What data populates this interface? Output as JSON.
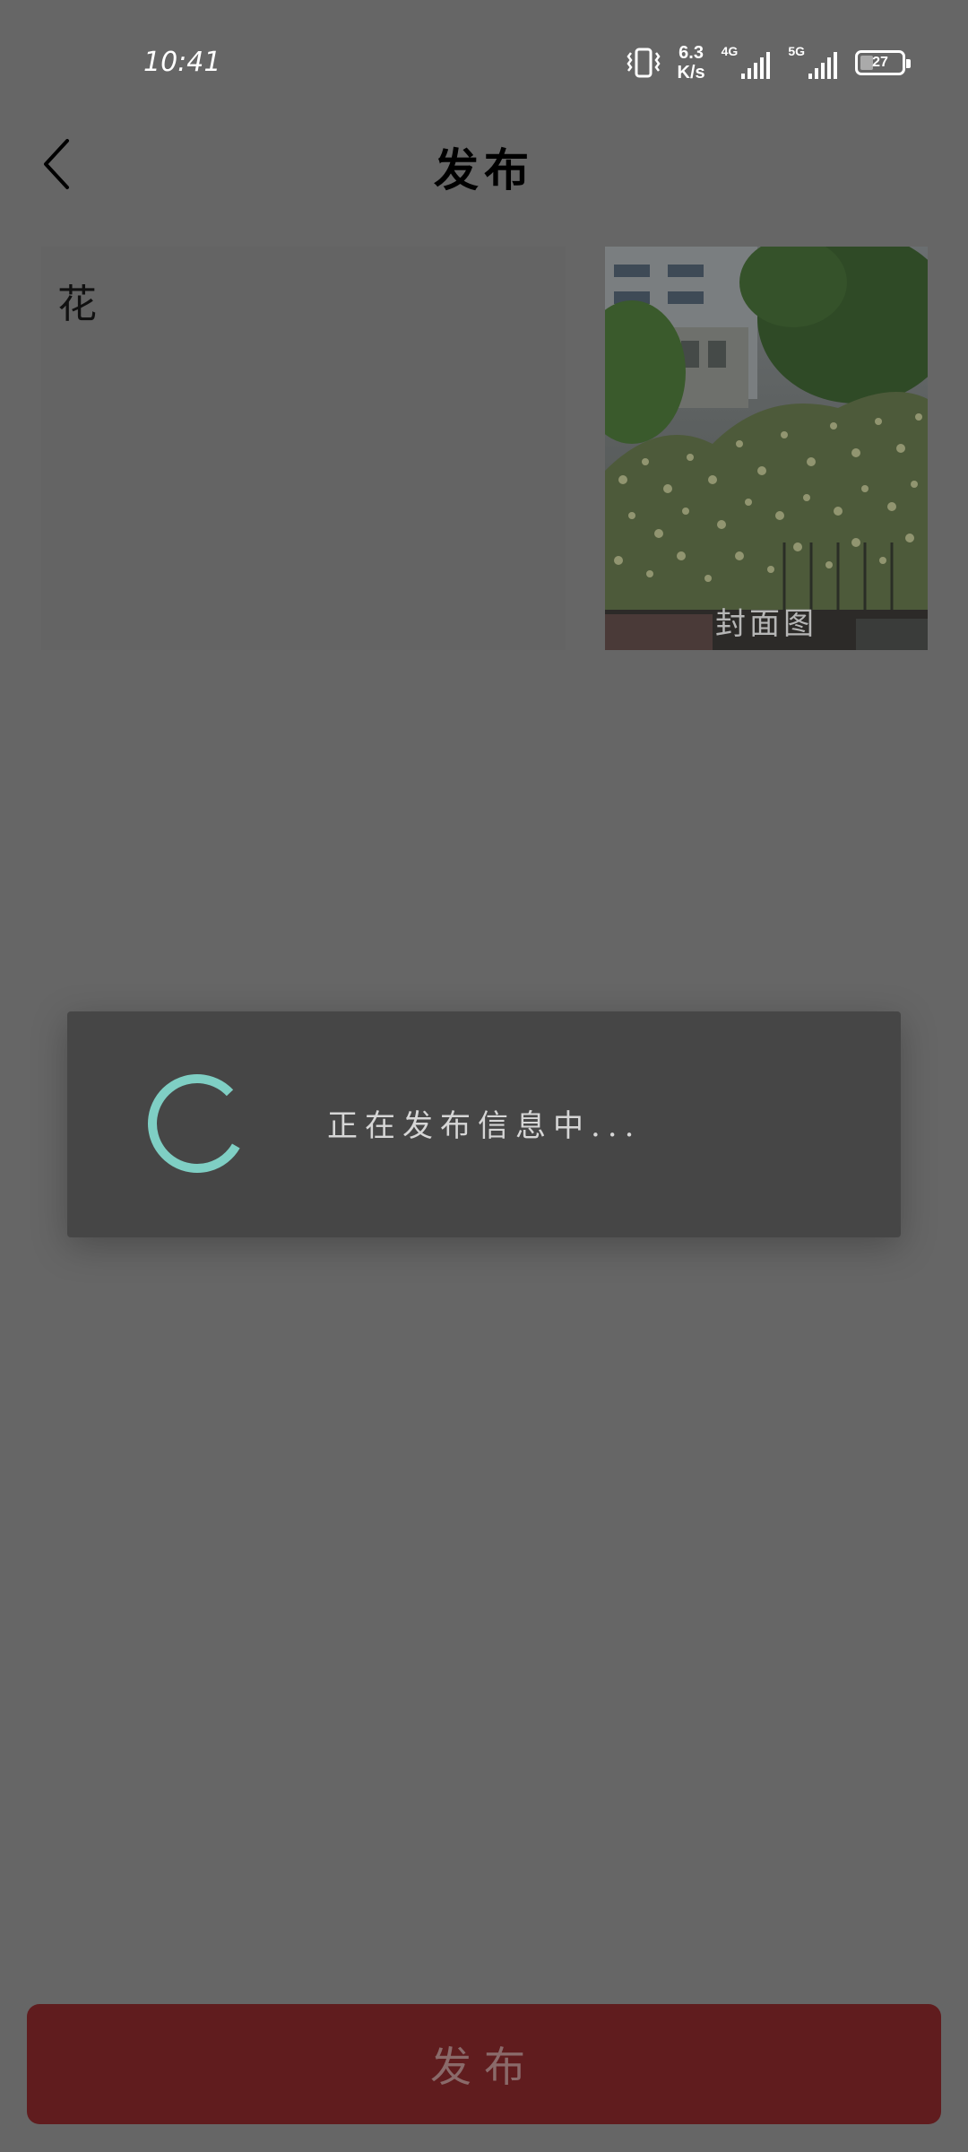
{
  "status_bar": {
    "time": "10:41",
    "speed_value": "6.3",
    "speed_unit": "K/s",
    "network_4g": "4G",
    "network_5g": "5G",
    "battery_level": "27",
    "icons": [
      "vibrate-icon",
      "signal-4g-icon",
      "signal-5g-icon",
      "battery-icon"
    ]
  },
  "header": {
    "title": "发布",
    "back_icon": "chevron-left-icon"
  },
  "post": {
    "text": "花",
    "cover_label": "封面图"
  },
  "loading": {
    "message": "正在发布信息中...",
    "spinner_color": "#7fcfc4"
  },
  "footer": {
    "publish_label": "发布",
    "publish_color": "#601c1e"
  }
}
